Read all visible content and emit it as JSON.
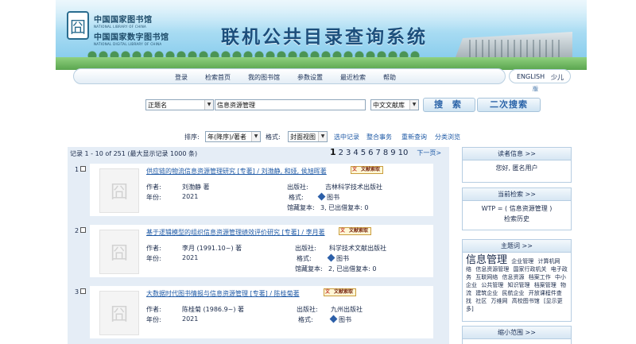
{
  "header": {
    "logo_line1": "中国国家图书馆",
    "logo_sub1": "NATIONAL LIBRARY OF CHINA",
    "logo_line2": "中国国家数字图书馆",
    "logo_sub2": "NATIONAL DIGITAL LIBRARY OF CHINA",
    "system_title": "联机公共目录查询系统"
  },
  "nav": {
    "items": [
      "登录",
      "检索首页",
      "我的图书馆",
      "参数设置",
      "最近检索",
      "帮助"
    ],
    "lang_english": "ENGLISH",
    "lang_minority_a": "少儿",
    "lang_minority_b": "版"
  },
  "search": {
    "field_select": "正题名",
    "query_value": "信息资源管理",
    "db_select": "中文文献库",
    "search_button": "搜 索",
    "second_search_button": "二次搜索"
  },
  "sortbar": {
    "sort_label": "排序:",
    "sort_value": "年(降序)/著者",
    "format_label": "格式:",
    "format_value": "封面视图",
    "links": [
      "选中记录",
      "整合事务",
      "重新查询",
      "分类浏览"
    ]
  },
  "results": {
    "record_info": "记录 1 - 10 of 251 (最大显示记录 1000 条)",
    "pages": [
      "1",
      "2",
      "3",
      "4",
      "5",
      "6",
      "7",
      "8",
      "9",
      "10"
    ],
    "current_page": "1",
    "next_page": "下一页>",
    "fulltext_badge": "文献索取",
    "labels": {
      "author": "作者:",
      "year": "年份:",
      "publisher": "出版社:",
      "format": "格式:",
      "holdings": "馆藏复本:"
    },
    "records": [
      {
        "index": "1",
        "title": "供应链的物流信息资源管理研究 [专著] / 刘渤静, 和娅, 侯旭晖著",
        "author": "刘渤静 著",
        "year": "2021",
        "publisher": "吉林科学技术出版社",
        "format": "图书",
        "holdings": "3, 已出借复本: 0"
      },
      {
        "index": "2",
        "title": "基于逻辑模型的组织信息资源管理绩效评价研究 [专著] / 李月著",
        "author": "李月 (1991.10~) 著",
        "year": "2021",
        "publisher": "科学技术文献出版社",
        "format": "图书",
        "holdings": "2, 已出借复本: 0"
      },
      {
        "index": "3",
        "title": "大数据时代图书情报与信息资源管理 [专著] / 陈桂菊著",
        "author": "陈桂菊 (1986.9~) 著",
        "year": "2021",
        "publisher": "九州出版社",
        "format": "图书",
        "holdings": "2, 已出借复本: 0"
      }
    ]
  },
  "sidebar": {
    "reader_title": "读者信息 >>",
    "reader_greeting": "您好, 匿名用户",
    "current_title": "当前检索 >>",
    "current_query": "WTP = ( 信息资源管理 )",
    "current_history": "检索历史",
    "subject_title": "主题词 >>",
    "subject_big": "信息管理",
    "subject_words": [
      "企业管理",
      "计算机网络",
      "信息资源管理",
      "国家行政机关",
      "电子政务",
      "互联网络",
      "信息资源",
      "档案工作",
      "中小企业",
      "公共管理",
      "知识管理",
      "档案管理",
      "物流",
      "建筑企业",
      "民航企业",
      "开放课程件查找",
      "社区",
      "万维网",
      "高校图书馆",
      "[显示更多]"
    ],
    "narrow_title": "缩小范围 >>"
  }
}
